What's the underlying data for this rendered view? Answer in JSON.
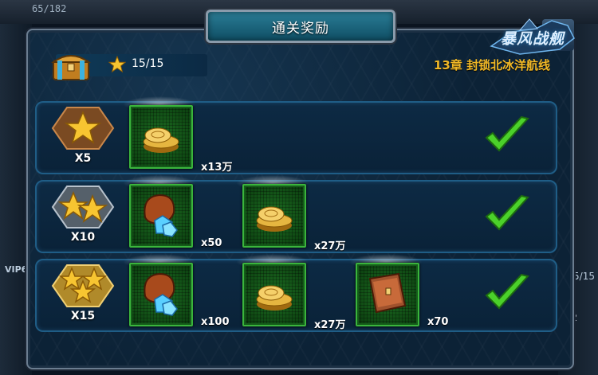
{
  "background": {
    "hp_text": "65/182",
    "vip_text": "VIP6",
    "page_text": "5/15",
    "count_text": "2"
  },
  "dialog": {
    "title": "通关奖励",
    "logo_text": "暴风战舰",
    "close_icon": "close-icon"
  },
  "header": {
    "stars_progress": "15/15",
    "chapter": "13章  封锁北冰洋航线"
  },
  "rows": [
    {
      "stars": 1,
      "badge_label": "X5",
      "rewards": [
        {
          "icon": "gold-coins-icon",
          "qty": "x13万"
        }
      ],
      "claimed": true
    },
    {
      "stars": 2,
      "badge_label": "X10",
      "rewards": [
        {
          "icon": "crystal-pouch-icon",
          "qty": "x50"
        },
        {
          "icon": "gold-coins-icon",
          "qty": "x27万"
        }
      ],
      "claimed": true
    },
    {
      "stars": 3,
      "badge_label": "X15",
      "rewards": [
        {
          "icon": "crystal-pouch-icon",
          "qty": "x100"
        },
        {
          "icon": "gold-coins-icon",
          "qty": "x27万"
        },
        {
          "icon": "book-icon",
          "qty": "x70"
        }
      ],
      "claimed": true
    }
  ],
  "colors": {
    "accent_gold": "#f1b826",
    "slot_border": "#3ab53c",
    "check_green": "#4bd12a",
    "title_bg": "#1e6c86"
  }
}
